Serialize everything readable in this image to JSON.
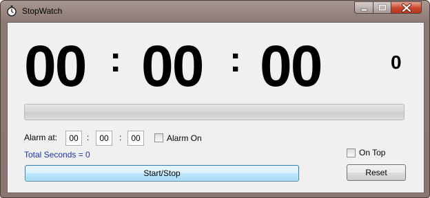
{
  "window": {
    "title": "StopWatch",
    "icon": "stopwatch-icon"
  },
  "display": {
    "hours": "00",
    "minutes": "00",
    "seconds": "00",
    "separator": ":",
    "milliseconds": "0"
  },
  "progress": {
    "value": 0
  },
  "alarm": {
    "label": "Alarm at:",
    "hours": "00",
    "minutes": "00",
    "seconds": "00",
    "separator": ":",
    "checkbox_label": "Alarm On",
    "checked": false
  },
  "on_top": {
    "label": "On Top",
    "checked": false
  },
  "total_seconds": "Total Seconds = 0",
  "buttons": {
    "start_stop": "Start/Stop",
    "reset": "Reset"
  }
}
